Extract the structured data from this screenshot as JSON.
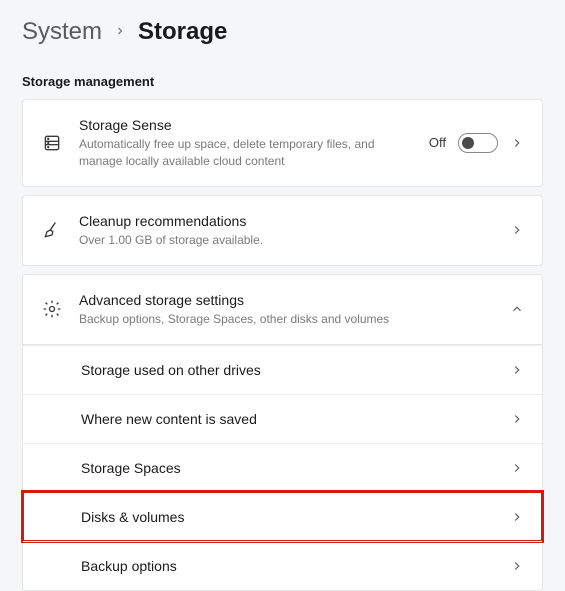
{
  "breadcrumb": {
    "parent": "System",
    "current": "Storage"
  },
  "section_header": "Storage management",
  "storage_sense": {
    "title": "Storage Sense",
    "subtitle": "Automatically free up space, delete temporary files, and manage locally available cloud content",
    "toggle_label": "Off",
    "toggle_state": false
  },
  "cleanup": {
    "title": "Cleanup recommendations",
    "subtitle": "Over 1.00 GB of storage available."
  },
  "advanced": {
    "title": "Advanced storage settings",
    "subtitle": "Backup options, Storage Spaces, other disks and volumes",
    "expanded": true,
    "items": [
      {
        "label": "Storage used on other drives"
      },
      {
        "label": "Where new content is saved"
      },
      {
        "label": "Storage Spaces"
      },
      {
        "label": "Disks & volumes",
        "highlight": true
      },
      {
        "label": "Backup options"
      }
    ]
  }
}
